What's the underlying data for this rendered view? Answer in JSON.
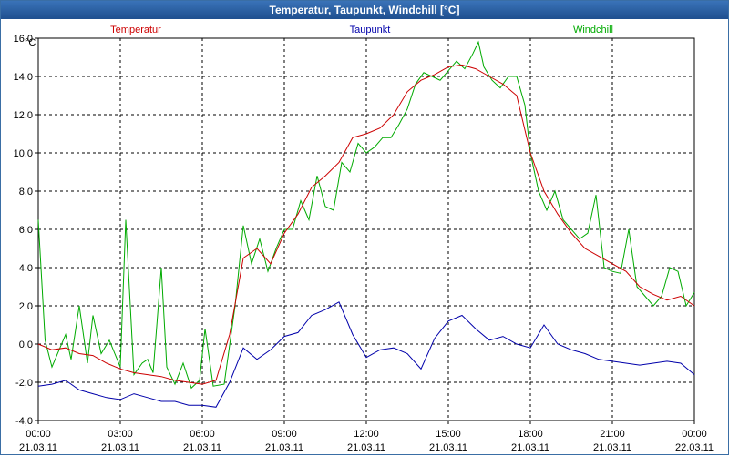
{
  "window": {
    "title": "Temperatur, Taupunkt, Windchill [°C]"
  },
  "chart_data": {
    "type": "line",
    "title": "Temperatur, Taupunkt, Windchill [°C]",
    "ylabel": "°C",
    "xlabel": "",
    "ylim": [
      -4.0,
      16.0
    ],
    "xlim_hours": [
      0,
      24
    ],
    "grid": true,
    "legend_placement": "top",
    "y_ticks": [
      "-4,0",
      "-2,0",
      "0,0",
      "2,0",
      "4,0",
      "6,0",
      "8,0",
      "10,0",
      "12,0",
      "14,0",
      "16,0"
    ],
    "x_ticks": [
      {
        "time": "00:00",
        "date": "21.03.11"
      },
      {
        "time": "03:00",
        "date": "21.03.11"
      },
      {
        "time": "06:00",
        "date": "21.03.11"
      },
      {
        "time": "09:00",
        "date": "21.03.11"
      },
      {
        "time": "12:00",
        "date": "21.03.11"
      },
      {
        "time": "15:00",
        "date": "21.03.11"
      },
      {
        "time": "18:00",
        "date": "21.03.11"
      },
      {
        "time": "21:00",
        "date": "21.03.11"
      },
      {
        "time": "00:00",
        "date": "22.03.11"
      }
    ],
    "series": [
      {
        "name": "Temperatur",
        "color": "#cc0000",
        "x": [
          0,
          0.5,
          1,
          1.5,
          2,
          2.5,
          3,
          3.5,
          4,
          4.5,
          5,
          5.5,
          6,
          6.5,
          7,
          7.5,
          8,
          8.5,
          9,
          9.5,
          10,
          10.5,
          11,
          11.5,
          12,
          12.5,
          13,
          13.5,
          14,
          14.5,
          15,
          15.5,
          16,
          16.5,
          17,
          17.5,
          18,
          18.5,
          19,
          19.5,
          20,
          20.5,
          21,
          21.5,
          22,
          22.5,
          23,
          23.5,
          24
        ],
        "y": [
          0,
          -0.3,
          -0.2,
          -0.5,
          -0.6,
          -1.0,
          -1.3,
          -1.5,
          -1.6,
          -1.7,
          -1.9,
          -2.0,
          -2.1,
          -1.9,
          0.5,
          4.5,
          5.0,
          4.2,
          5.8,
          6.8,
          8.2,
          8.8,
          9.5,
          10.8,
          11.0,
          11.3,
          12.0,
          13.2,
          13.8,
          14.1,
          14.5,
          14.6,
          14.4,
          14.0,
          13.6,
          13.0,
          10.0,
          8.0,
          6.8,
          5.8,
          5.0,
          4.6,
          4.2,
          3.8,
          3.0,
          2.6,
          2.3,
          2.5,
          2.0
        ]
      },
      {
        "name": "Taupunkt",
        "color": "#0000aa",
        "x": [
          0,
          0.5,
          1,
          1.5,
          2,
          2.5,
          3,
          3.5,
          4,
          4.5,
          5,
          5.5,
          6,
          6.5,
          7,
          7.5,
          8,
          8.5,
          9,
          9.5,
          10,
          10.5,
          11,
          11.5,
          12,
          12.5,
          13,
          13.5,
          14,
          14.5,
          15,
          15.5,
          16,
          16.5,
          17,
          17.5,
          18,
          18.5,
          19,
          19.5,
          20,
          20.5,
          21,
          21.5,
          22,
          22.5,
          23,
          23.5,
          24
        ],
        "y": [
          -2.2,
          -2.1,
          -1.9,
          -2.4,
          -2.6,
          -2.8,
          -2.9,
          -2.6,
          -2.8,
          -3.0,
          -3.0,
          -3.2,
          -3.2,
          -3.3,
          -2.0,
          -0.2,
          -0.8,
          -0.3,
          0.4,
          0.6,
          1.5,
          1.8,
          2.2,
          0.5,
          -0.7,
          -0.3,
          -0.2,
          -0.5,
          -1.3,
          0.3,
          1.2,
          1.5,
          0.8,
          0.2,
          0.4,
          0.0,
          -0.2,
          1.0,
          0.0,
          -0.3,
          -0.5,
          -0.8,
          -0.9,
          -1.0,
          -1.1,
          -1.0,
          -0.9,
          -1.0,
          -1.6
        ]
      },
      {
        "name": "Windchill",
        "color": "#00aa00",
        "x": [
          0,
          0.25,
          0.5,
          1,
          1.2,
          1.5,
          1.8,
          2,
          2.3,
          2.6,
          3,
          3.2,
          3.5,
          3.8,
          4,
          4.2,
          4.5,
          4.7,
          5,
          5.3,
          5.6,
          5.9,
          6.1,
          6.4,
          6.8,
          7.2,
          7.5,
          7.8,
          8.1,
          8.4,
          8.7,
          9,
          9.3,
          9.6,
          9.9,
          10.2,
          10.5,
          10.8,
          11.1,
          11.4,
          11.7,
          12,
          12.3,
          12.6,
          12.9,
          13.2,
          13.5,
          13.8,
          14.1,
          14.4,
          14.7,
          15,
          15.3,
          15.6,
          15.9,
          16.1,
          16.3,
          16.6,
          16.9,
          17.2,
          17.5,
          17.8,
          18,
          18.3,
          18.6,
          18.9,
          19.2,
          19.5,
          19.8,
          20.1,
          20.4,
          20.7,
          21,
          21.3,
          21.6,
          21.9,
          22.2,
          22.5,
          22.8,
          23.1,
          23.4,
          23.7,
          24
        ],
        "y": [
          6.5,
          0.2,
          -1.2,
          0.5,
          -0.8,
          2.0,
          -1.0,
          1.5,
          -0.5,
          0.2,
          -1.2,
          6.5,
          -1.6,
          -1.0,
          -0.8,
          -1.5,
          4.0,
          -1.2,
          -2.1,
          -1.0,
          -2.3,
          -1.9,
          0.8,
          -2.2,
          -2.1,
          2.0,
          6.2,
          4.2,
          5.5,
          3.8,
          5.0,
          6.0,
          6.0,
          7.5,
          6.5,
          8.8,
          7.2,
          7.0,
          9.5,
          9.0,
          10.5,
          10.0,
          10.3,
          10.8,
          10.8,
          11.5,
          12.3,
          13.6,
          14.2,
          14.0,
          13.8,
          14.3,
          14.8,
          14.4,
          15.2,
          15.8,
          14.5,
          13.8,
          13.4,
          14.0,
          14.0,
          12.5,
          10.0,
          8.0,
          7.0,
          8.0,
          6.5,
          6.0,
          5.5,
          5.8,
          7.8,
          4.0,
          3.8,
          3.7,
          6.0,
          3.0,
          2.5,
          2.0,
          2.5,
          4.0,
          3.8,
          2.0,
          2.7
        ]
      }
    ]
  }
}
